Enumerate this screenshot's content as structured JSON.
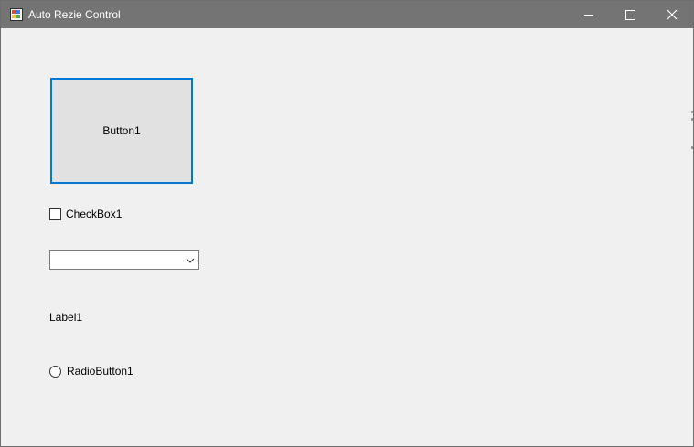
{
  "window": {
    "title": "Auto Rezie Control",
    "app_icon": "winforms-app-icon",
    "controls": {
      "minimize_icon": "minimize-icon",
      "maximize_icon": "maximize-icon",
      "close_icon": "close-icon"
    }
  },
  "form": {
    "button1": {
      "label": "Button1"
    },
    "checkbox1": {
      "label": "CheckBox1",
      "checked": false
    },
    "combobox1": {
      "value": "",
      "arrow_icon": "chevron-down-icon"
    },
    "label1": {
      "text": "Label1"
    },
    "radiobutton1": {
      "label": "RadioButton1",
      "checked": false
    }
  },
  "colors": {
    "titlebar": "#747474",
    "client_background": "#f0f0f0",
    "focus_border": "#0078d7",
    "button_face": "#e1e1e1"
  }
}
